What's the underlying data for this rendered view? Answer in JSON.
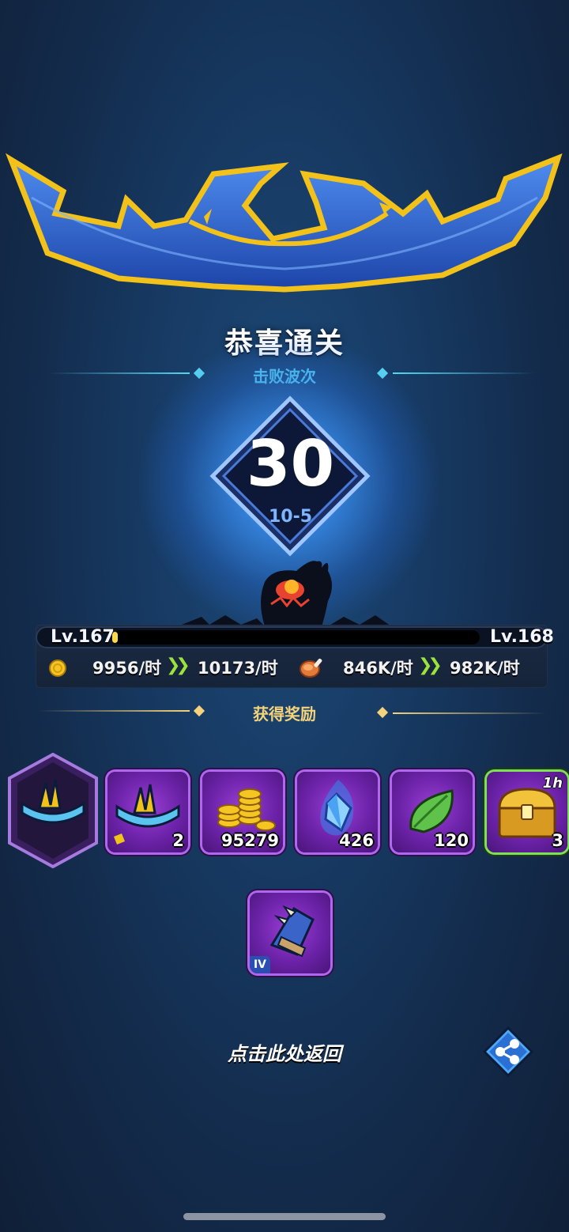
{
  "header": {
    "title": "恭喜通关",
    "subtitle": "击败波次"
  },
  "wave": {
    "number": "30",
    "stage": "10-5"
  },
  "progress": {
    "level_current": "Lv.167",
    "level_next": "Lv.168",
    "xp_fraction": 0.01
  },
  "rates": {
    "gold_before": "9956/时",
    "gold_after": "10173/时",
    "food_before": "846K/时",
    "food_after": "982K/时",
    "arrows": "❯❯"
  },
  "rewards": {
    "title": "获得奖励",
    "items": [
      {
        "icon": "crown-piece-icon",
        "count": ""
      },
      {
        "icon": "crown-fragment-icon",
        "count": "2"
      },
      {
        "icon": "gold-coins-icon",
        "count": "95279"
      },
      {
        "icon": "blue-crystal-icon",
        "count": "426"
      },
      {
        "icon": "green-leaf-icon",
        "count": "120"
      },
      {
        "icon": "treasure-chest-icon",
        "count": "3",
        "tag": "1h"
      },
      {
        "icon": "gauntlet-icon",
        "tier": "IV"
      }
    ]
  },
  "footer": {
    "back_label": "点击此处返回"
  },
  "colors": {
    "accent_cyan": "#59d6f2",
    "gold": "#f4d37a",
    "card_border": "#b067f0",
    "chest_border": "#7ee05a",
    "arrow_green": "#9be23c"
  }
}
